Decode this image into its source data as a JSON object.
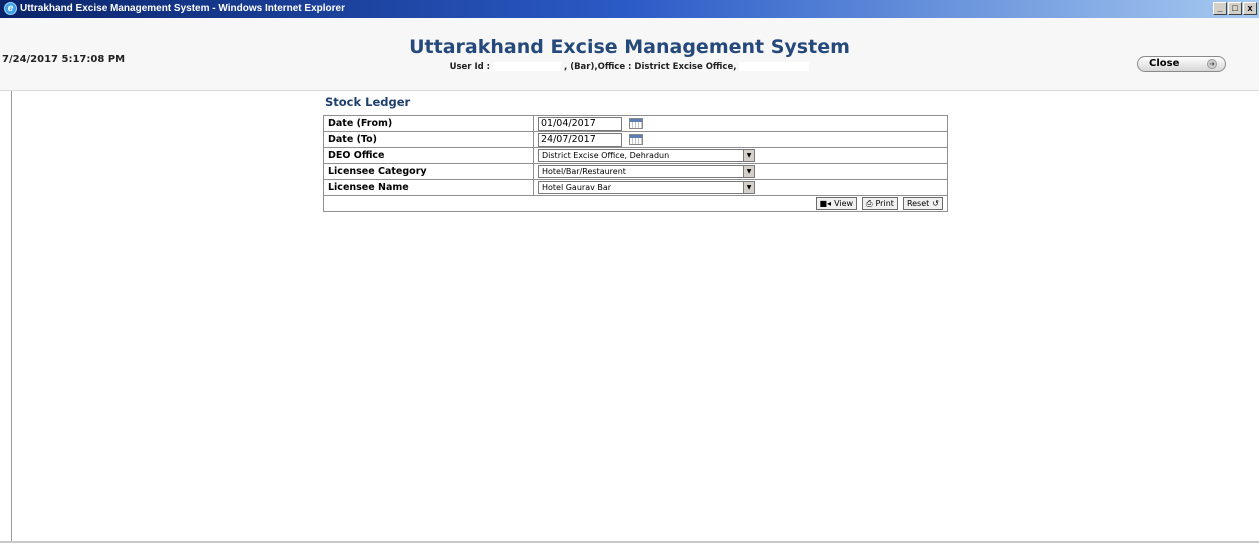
{
  "window": {
    "title": "Uttrakhand Excise Management System - Windows Internet Explorer",
    "controls": [
      "_",
      "□",
      "x"
    ]
  },
  "header": {
    "datetime": "7/24/2017 5:17:08 PM",
    "app_title": "Uttarakhand Excise Management System",
    "user_label": "User Id :",
    "user_suffix": ", (Bar),Office : District Excise Office,",
    "close_label": "Close"
  },
  "form": {
    "title": "Stock Ledger",
    "fields": {
      "date_from": {
        "label": "Date (From)",
        "value": "01/04/2017"
      },
      "date_to": {
        "label": "Date (To)",
        "value": "24/07/2017"
      },
      "deo_office": {
        "label": "DEO Office",
        "value": "District Excise Office, Dehradun"
      },
      "licensee_category": {
        "label": "Licensee Category",
        "value": "Hotel/Bar/Restaurent"
      },
      "licensee_name": {
        "label": "Licensee Name",
        "value": "Hotel Gaurav Bar"
      }
    },
    "actions": {
      "view": "View",
      "print": "Print",
      "reset": "Reset"
    }
  }
}
